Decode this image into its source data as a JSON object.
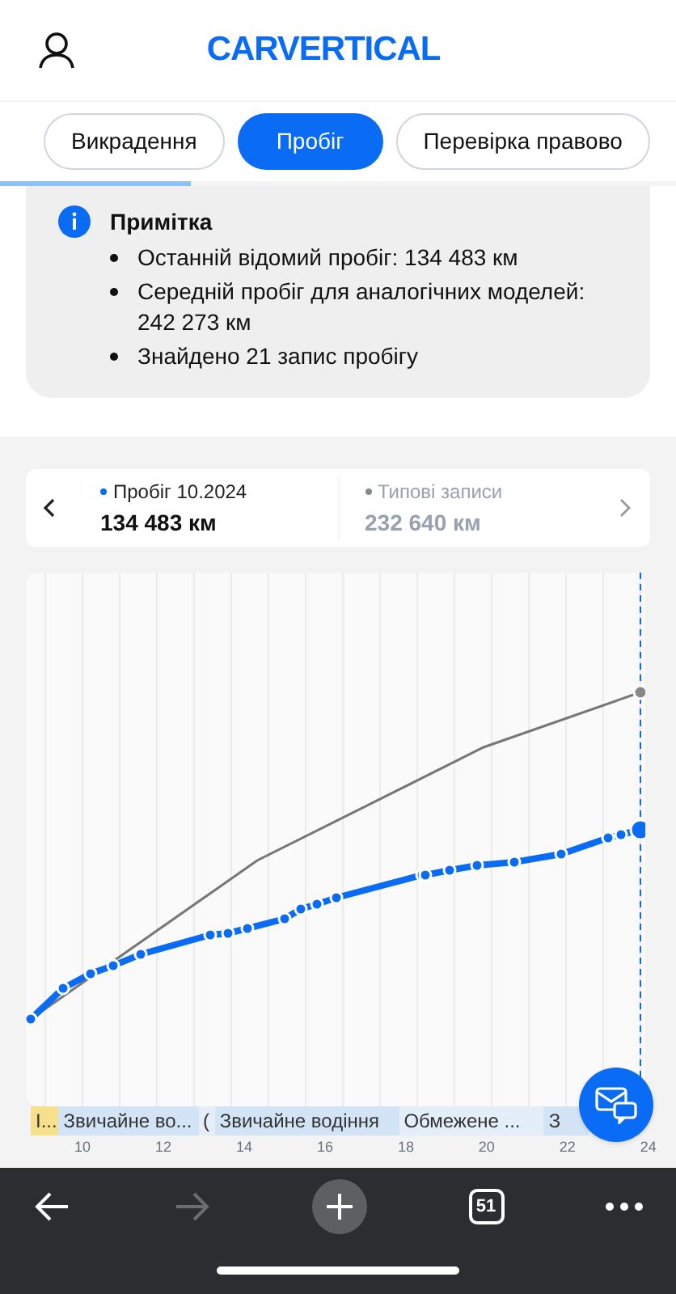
{
  "header": {
    "logo": "CARVERTICAL"
  },
  "tabs": [
    {
      "label": "Викрадення",
      "selected": false
    },
    {
      "label": "Пробіг",
      "selected": true
    },
    {
      "label": "Перевірка правово",
      "selected": false
    }
  ],
  "note": {
    "title": "Примітка",
    "items": [
      "Останній відомий пробіг: 134 483 км",
      "Середній пробіг для аналогічних моделей: 242 273 км",
      "Знайдено 21 запис пробігу"
    ]
  },
  "summary": [
    {
      "label": "Пробіг 10.2024",
      "value": "134 483 км",
      "color": "#0a6cf5"
    },
    {
      "label": "Типові записи",
      "value": "232 640 км",
      "color": "#8a8a8a"
    }
  ],
  "timeline": [
    {
      "label": "І...",
      "color": "#f7e08c"
    },
    {
      "label": "Звичайне во...",
      "color": "#d3e4f7"
    },
    {
      "label": "(",
      "color": "#e4eef9"
    },
    {
      "label": "Звичайне водіння",
      "color": "#d3e4f7"
    },
    {
      "label": "Обмежене ...",
      "color": "#e4eef9"
    },
    {
      "label": "З",
      "color": "#d3e4f7"
    }
  ],
  "x_ticks": [
    "10",
    "12",
    "14",
    "16",
    "18",
    "20",
    "22",
    "24"
  ],
  "toolbar": {
    "tabs_count": "51",
    "forward_disabled": true
  }
}
